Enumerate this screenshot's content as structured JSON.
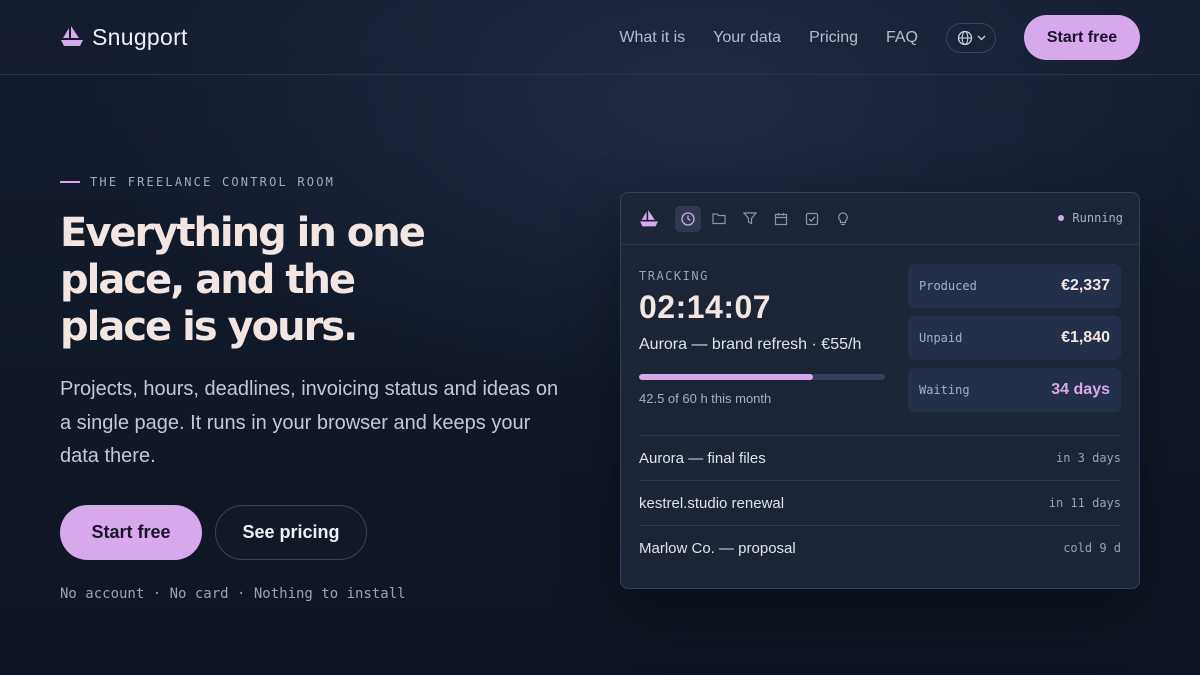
{
  "brand": {
    "name": "Snugport",
    "logo_icon": "boat-icon",
    "accent": "#d7a8ec"
  },
  "nav": {
    "links": [
      "What it is",
      "Your data",
      "Pricing",
      "FAQ"
    ],
    "language_icon": "globe-icon",
    "cta": "Start free"
  },
  "hero": {
    "eyebrow": "THE FREELANCE CONTROL ROOM",
    "headline_lines": [
      "Everything in one",
      "place, and the",
      "place is yours."
    ],
    "lede": "Projects, hours, deadlines, invoicing status and ideas on a single page. It runs in your browser and keeps your data there.",
    "primary_cta": "Start free",
    "secondary_cta": "See pricing",
    "fine_print": "No account · No card · Nothing to install"
  },
  "card": {
    "toolbar_icons": [
      "clock-icon",
      "folder-icon",
      "filter-icon",
      "calendar-icon",
      "checkbox-icon",
      "lightbulb-icon"
    ],
    "status": "Running",
    "tracking_label": "TRACKING",
    "timer": "02:14:07",
    "project": "Aurora — brand refresh · €55/h",
    "progress_fraction": 0.708,
    "hours": "42.5 of 60 h this month",
    "stats": [
      {
        "label": "Produced",
        "value": "€2,337"
      },
      {
        "label": "Unpaid",
        "value": "€1,840"
      },
      {
        "label": "Waiting",
        "value": "34 days"
      }
    ],
    "tasks": [
      {
        "name": "Aurora — final files",
        "due": "in 3 days"
      },
      {
        "name": "kestrel.studio renewal",
        "due": "in 11 days"
      },
      {
        "name": "Marlow Co. — proposal",
        "due": "cold 9 d"
      }
    ]
  }
}
